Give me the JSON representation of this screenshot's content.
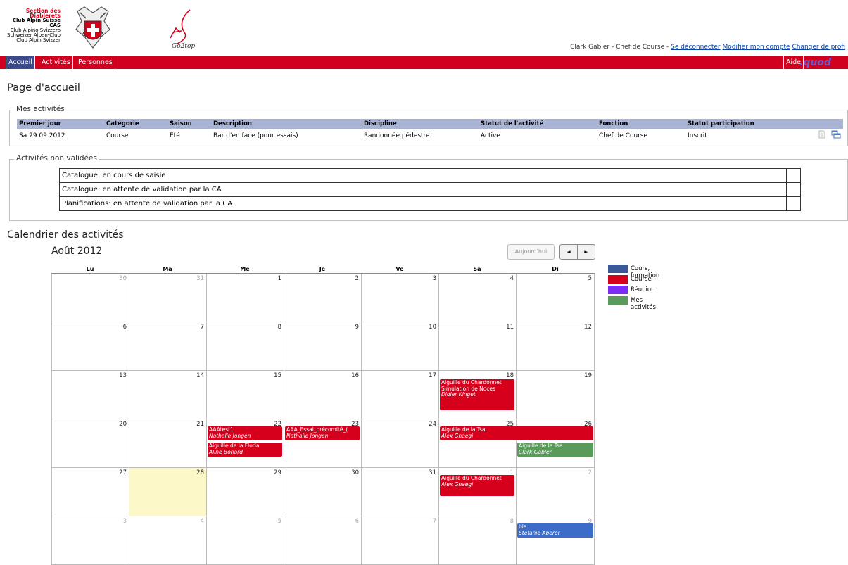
{
  "header": {
    "logo_lines": [
      "Section des Diablerets",
      "Club Alpin Suisse CAS",
      "Club Alpino Svizzero",
      "Schweizer Alpen-Club",
      "Club Alpin Svizzer"
    ],
    "go2top": "Go2top",
    "user": "Clark Gabler - Chef de Course - ",
    "logout": "Se déconnecter",
    "modify": "Modifier mon compte",
    "change": "Changer de profi"
  },
  "nav": {
    "accueil": "Accueil",
    "activites": "Activités",
    "personnes": "Personnes",
    "aide": "Aide",
    "logo": ".quod"
  },
  "page_title": "Page d'accueil",
  "mes_activites": {
    "legend": "Mes activités",
    "columns": [
      "Premier jour",
      "Catégorie",
      "Saison",
      "Description",
      "Discipline",
      "Statut de l'activité",
      "Fonction",
      "Statut participation"
    ],
    "rows": [
      [
        "Sa 29.09.2012",
        "Course",
        "Été",
        "Bar d'en face (pour essais)",
        "Randonnée pédestre",
        "Active",
        "Chef de Course",
        "Inscrit"
      ]
    ]
  },
  "non_validees": {
    "legend": "Activités non validées",
    "rows": [
      "Catalogue: en cours de saisie",
      "Catalogue: en attente de validation par la CA",
      "Planifications: en attente de validation par la CA"
    ]
  },
  "calendar": {
    "title": "Calendrier des activités",
    "month": "Août 2012",
    "today_btn": "Aujourd'hui",
    "prev": "◄",
    "next": "►",
    "days": [
      "Lu",
      "Ma",
      "Me",
      "Je",
      "Ve",
      "Sa",
      "Di"
    ],
    "weeks": [
      [
        "30",
        "31",
        "1",
        "2",
        "3",
        "4",
        "5"
      ],
      [
        "6",
        "7",
        "8",
        "9",
        "10",
        "11",
        "12"
      ],
      [
        "13",
        "14",
        "15",
        "16",
        "17",
        "18",
        "19"
      ],
      [
        "20",
        "21",
        "22",
        "23",
        "24",
        "25",
        "26"
      ],
      [
        "27",
        "28",
        "29",
        "30",
        "31",
        "1",
        "2"
      ],
      [
        "3",
        "4",
        "5",
        "6",
        "7",
        "8",
        "9"
      ]
    ],
    "events": [
      {
        "title": "Aiguille du Chardonnet",
        "extra": "Simulation de Noces",
        "who": "Didier Kinget",
        "color": "red"
      },
      {
        "title": "AAAtest1",
        "who": "Nathalie Jongen",
        "color": "red"
      },
      {
        "title": "Aiguille de la Floria",
        "who": "Aline Bonard",
        "color": "red"
      },
      {
        "title": "AAA_Essai_précomité_(",
        "who": "Nathalie Jongen",
        "color": "red"
      },
      {
        "title": "Aiguille de la Tsa",
        "who": "Alex Gnaegi",
        "color": "red"
      },
      {
        "title": "Aiguille de la Tsa",
        "who": "Clark Gabler",
        "color": "green"
      },
      {
        "title": "Aiguille du Chardonnet",
        "who": "Alex Gnaegi",
        "color": "red"
      },
      {
        "title": "bla",
        "who": "Stefanie Aberer",
        "color": "blue"
      }
    ]
  },
  "legend": [
    {
      "label": "Cours, formation",
      "color": "#3b5998"
    },
    {
      "label": "Course",
      "color": "#d6001c"
    },
    {
      "label": "Réunion",
      "color": "#7b2cf5"
    },
    {
      "label": "Mes activités",
      "color": "#5a9a5a"
    }
  ]
}
